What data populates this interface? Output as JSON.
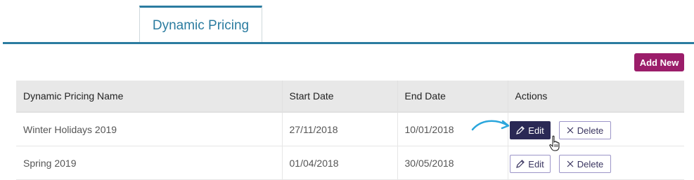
{
  "tabs": [
    {
      "label": "Dynamic Pricing",
      "active": true
    }
  ],
  "toolbar": {
    "add_new_label": "Add New"
  },
  "table": {
    "columns": [
      "Dynamic Pricing Name",
      "Start Date",
      "End Date",
      "Actions"
    ],
    "rows": [
      {
        "name": "Winter Holidays 2019",
        "start": "27/11/2018",
        "end": "10/01/2018",
        "edit_label": "Edit",
        "delete_label": "Delete",
        "edit_active": true
      },
      {
        "name": "Spring 2019",
        "start": "01/04/2018",
        "end": "30/05/2018",
        "edit_label": "Edit",
        "delete_label": "Delete",
        "edit_active": false
      }
    ]
  },
  "colors": {
    "accent": "#2b7ca0",
    "add_button": "#9b1d6a",
    "edit_active": "#2a2955",
    "button_border": "#9c95c8",
    "arrow": "#2aa6dc"
  },
  "icons": {
    "edit": "pencil-icon",
    "delete": "close-icon",
    "annotation": "curved-arrow-icon",
    "pointer": "hand-cursor-icon"
  }
}
